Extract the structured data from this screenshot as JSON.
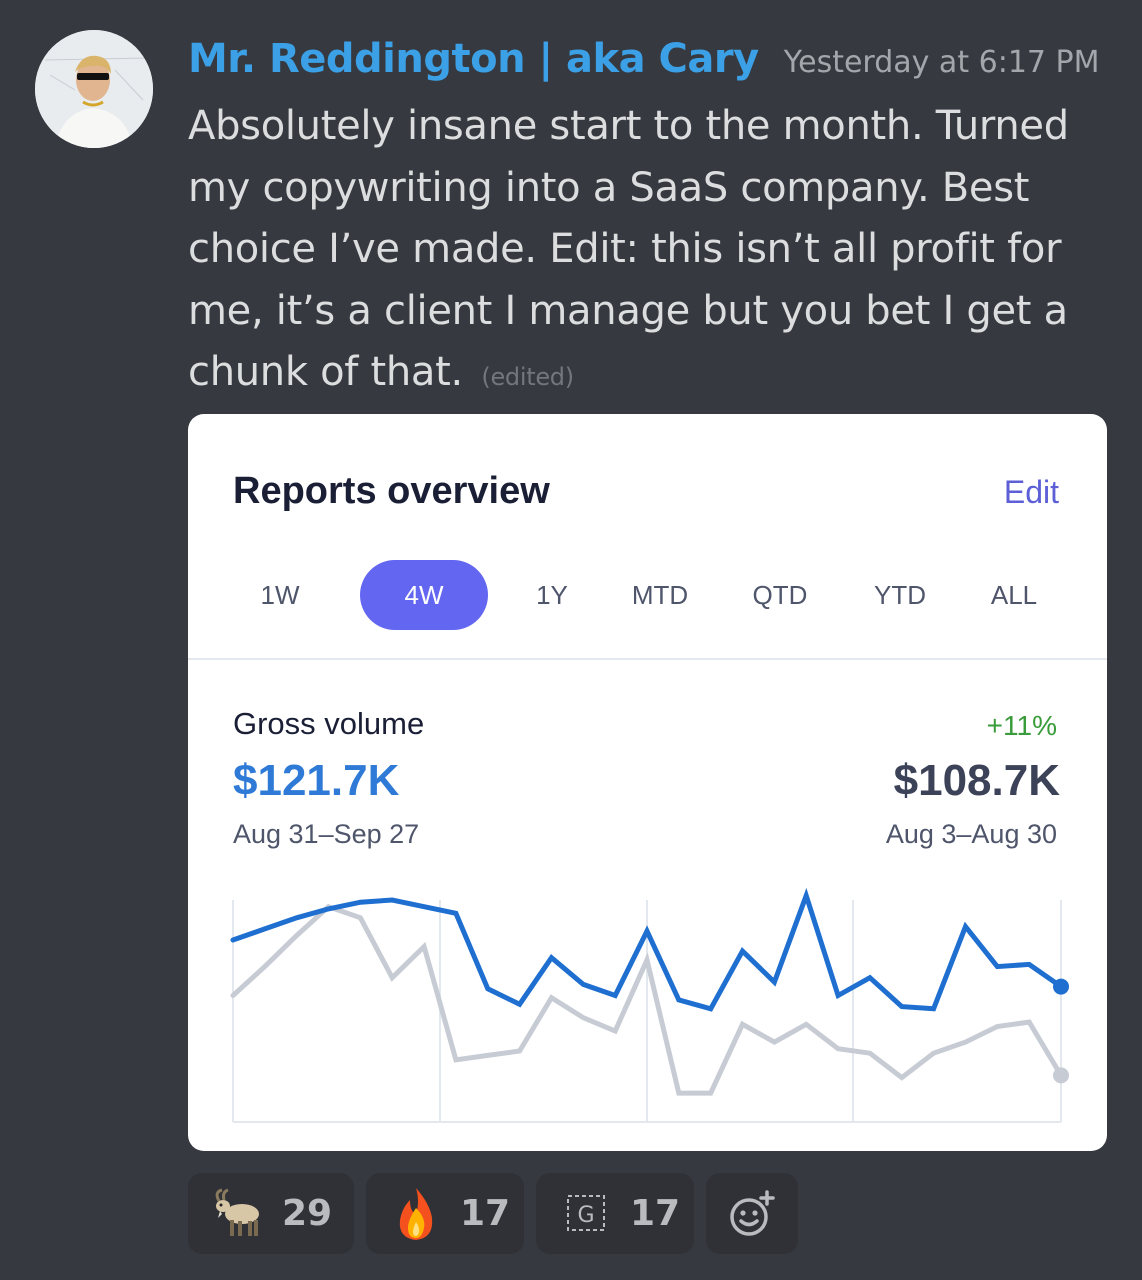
{
  "message": {
    "author": "Mr. Reddington | aka Cary",
    "timestamp": "Yesterday at 6:17 PM",
    "text": "Absolutely insane start to the month. Turned my copywriting into a SaaS company. Best choice I’ve made. Edit: this isn’t all profit for me, it’s a client I manage but you bet I get a chunk of that.",
    "edited_label": "(edited)"
  },
  "card": {
    "title": "Reports overview",
    "edit_label": "Edit",
    "tabs": [
      "1W",
      "4W",
      "1Y",
      "MTD",
      "QTD",
      "YTD",
      "ALL"
    ],
    "active_tab": "4W",
    "metric_label": "Gross volume",
    "current_value": "$121.7K",
    "current_range": "Aug 31–Sep 27",
    "change": "+11%",
    "previous_value": "$108.7K",
    "previous_range": "Aug 3–Aug 30"
  },
  "chart_data": {
    "type": "line",
    "series": [
      {
        "color": "#1f6fd1",
        "values": [
          0.82,
          0.87,
          0.92,
          0.96,
          0.99,
          1.0,
          0.97,
          0.94,
          0.6,
          0.53,
          0.74,
          0.62,
          0.57,
          0.86,
          0.55,
          0.51,
          0.77,
          0.63,
          1.02,
          0.57,
          0.65,
          0.52,
          0.51,
          0.88,
          0.7,
          0.71,
          0.61
        ]
      },
      {
        "color": "#c7cbd4",
        "values": [
          0.57,
          0.7,
          0.84,
          0.97,
          0.92,
          0.65,
          0.79,
          0.28,
          0.3,
          0.32,
          0.56,
          0.47,
          0.41,
          0.73,
          0.13,
          0.13,
          0.44,
          0.36,
          0.44,
          0.33,
          0.31,
          0.2,
          0.31,
          0.36,
          0.43,
          0.45,
          0.21
        ]
      }
    ],
    "colors": {
      "current": "#1f6fd1",
      "previous": "#c7cbd4"
    },
    "grid": true,
    "legend": "none"
  },
  "reactions": [
    {
      "emoji": "goat",
      "count": "29"
    },
    {
      "emoji": "fire",
      "count": "17"
    },
    {
      "emoji": "custom-g",
      "count": "17"
    }
  ],
  "add_reaction": "add-reaction-icon"
}
